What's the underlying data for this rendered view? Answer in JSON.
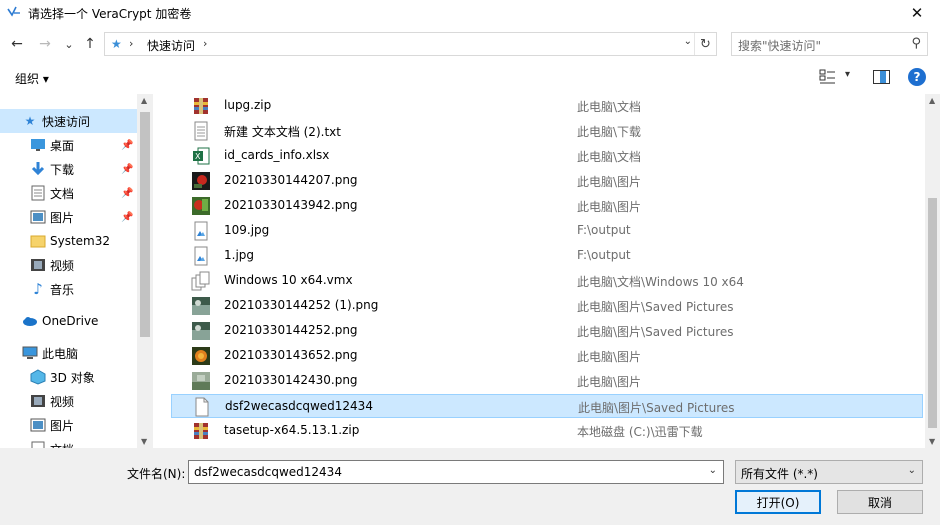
{
  "window": {
    "title": "请选择一个 VeraCrypt 加密卷",
    "close": "✕"
  },
  "nav": {
    "back": "←",
    "forward": "→",
    "recent": "⌄",
    "up": "↑",
    "address": {
      "path": "快速访问",
      "sep": "›",
      "dropdown": "⌄",
      "refresh": "↻"
    },
    "search": {
      "placeholder": "搜索\"快速访问\"",
      "icon": "⚲"
    }
  },
  "toolbar": {
    "organize": "组织 ▾",
    "view_dropdown": "▾",
    "help": "?"
  },
  "sidebar": {
    "items": [
      {
        "label": "快速访问",
        "icon": "star-icon"
      },
      {
        "label": "桌面",
        "icon": "desktop-icon"
      },
      {
        "label": "下载",
        "icon": "download-icon"
      },
      {
        "label": "文档",
        "icon": "document-icon"
      },
      {
        "label": "图片",
        "icon": "picture-icon"
      },
      {
        "label": "System32",
        "icon": "folder-icon"
      },
      {
        "label": "视频",
        "icon": "video-icon"
      },
      {
        "label": "音乐",
        "icon": "music-icon"
      },
      {
        "label": "OneDrive",
        "icon": "cloud-icon"
      },
      {
        "label": "此电脑",
        "icon": "computer-icon"
      },
      {
        "label": "3D 对象",
        "icon": "cube-icon"
      },
      {
        "label": "视频",
        "icon": "video-icon"
      },
      {
        "label": "图片",
        "icon": "picture-icon"
      },
      {
        "label": "文档",
        "icon": "document-icon"
      }
    ],
    "pin": "📌"
  },
  "files": [
    {
      "name": "lupg.zip",
      "location": "此电脑\\文档",
      "icon": "archive-icon"
    },
    {
      "name": "新建 文本文档 (2).txt",
      "location": "此电脑\\下载",
      "icon": "text-file-icon"
    },
    {
      "name": "id_cards_info.xlsx",
      "location": "此电脑\\文档",
      "icon": "excel-icon"
    },
    {
      "name": "20210330144207.png",
      "location": "此电脑\\图片",
      "icon": "image-thumb-icon"
    },
    {
      "name": "20210330143942.png",
      "location": "此电脑\\图片",
      "icon": "image-thumb-icon"
    },
    {
      "name": "109.jpg",
      "location": "F:\\output",
      "icon": "image-file-icon"
    },
    {
      "name": "1.jpg",
      "location": "F:\\output",
      "icon": "image-file-icon"
    },
    {
      "name": "Windows 10 x64.vmx",
      "location": "此电脑\\文档\\Windows 10 x64",
      "icon": "vmx-file-icon"
    },
    {
      "name": "20210330144252 (1).png",
      "location": "此电脑\\图片\\Saved Pictures",
      "icon": "image-thumb-icon"
    },
    {
      "name": "20210330144252.png",
      "location": "此电脑\\图片\\Saved Pictures",
      "icon": "image-thumb-icon"
    },
    {
      "name": "20210330143652.png",
      "location": "此电脑\\图片",
      "icon": "image-thumb-icon"
    },
    {
      "name": "20210330142430.png",
      "location": "此电脑\\图片",
      "icon": "image-thumb-icon"
    },
    {
      "name": "dsf2wecasdcqwed12434",
      "location": "此电脑\\图片\\Saved Pictures",
      "icon": "blank-file-icon"
    },
    {
      "name": "tasetup-x64.5.13.1.zip",
      "location": "本地磁盘 (C:)\\迅雷下载",
      "icon": "archive-icon"
    }
  ],
  "bottom": {
    "filename_label": "文件名(N):",
    "filename_value": "dsf2wecasdcqwed12434",
    "filter_value": "所有文件 (*.*)",
    "open_button": "打开(O)",
    "cancel_button": "取消"
  },
  "colors": {
    "selection": "#cce8ff",
    "accent": "#0078d7"
  }
}
